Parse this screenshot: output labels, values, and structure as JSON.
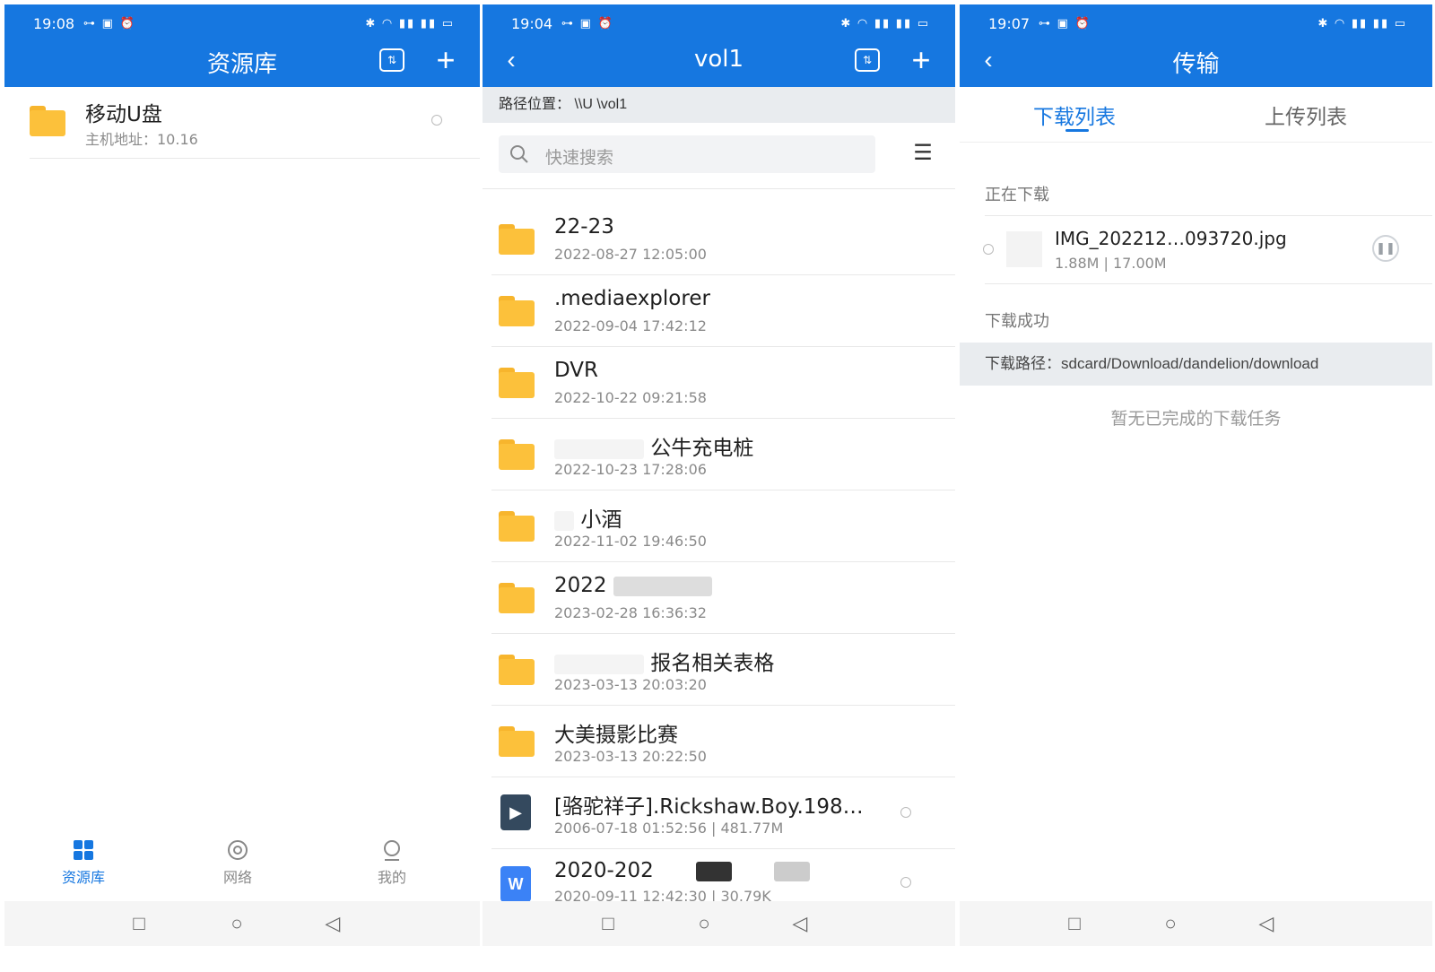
{
  "status_times": [
    "19:08",
    "19:04",
    "19:07"
  ],
  "status": {
    "left_icons": "⊶ ▣ ⏰",
    "right_icons": "✱ ◠ ▮▮ ▮▮ ▭"
  },
  "screen1": {
    "title": "资源库",
    "items": [
      {
        "name": "移动U盘",
        "meta": "主机地址：10.16"
      }
    ],
    "nav": [
      {
        "label": "资源库",
        "icon": "grid-icon",
        "active": true
      },
      {
        "label": "网络",
        "icon": "network-icon",
        "active": false
      },
      {
        "label": "我的",
        "icon": "user-icon",
        "active": false
      }
    ]
  },
  "screen2": {
    "title": "vol1",
    "path": "路径位置： \\\\U \\vol1",
    "search_placeholder": "快速搜索",
    "items": [
      {
        "name": "22-23",
        "meta": "2022-08-27 12:05:00",
        "type": "folder"
      },
      {
        "name": ".mediaexplorer",
        "meta": "2022-09-04 17:42:12",
        "type": "folder"
      },
      {
        "name": "DVR",
        "meta": "2022-10-22 09:21:58",
        "type": "folder"
      },
      {
        "name": "公牛充电桩",
        "meta": "2022-10-23 17:28:06",
        "type": "folder"
      },
      {
        "name": "小酒",
        "meta": "2022-11-02 19:46:50",
        "type": "folder"
      },
      {
        "name": "2022",
        "meta": "2023-02-28 16:36:32",
        "type": "folder"
      },
      {
        "name": "报名相关表格",
        "meta": "2023-03-13 20:03:20",
        "type": "folder"
      },
      {
        "name": "大美摄影比赛",
        "meta": "2023-03-13 20:22:50",
        "type": "folder"
      },
      {
        "name": "[骆驼祥子].Rickshaw.Boy.198…",
        "meta": "2006-07-18 01:52:56  |  481.77M",
        "type": "video"
      },
      {
        "name": "2020-202",
        "meta": "2020-09-11 12:42:30  |  30.79K",
        "type": "word"
      }
    ]
  },
  "screen3": {
    "title": "传输",
    "tabs": [
      "下载列表",
      "上传列表"
    ],
    "downloading_label": "正在下载",
    "download_item": {
      "name": "IMG_202212…093720.jpg",
      "meta": "1.88M | 17.00M"
    },
    "success_label": "下载成功",
    "download_path": "下载路径：sdcard/Download/dandelion/download",
    "empty_text": "暂无已完成的下载任务"
  },
  "colors": {
    "brand": "#1677e0",
    "folder": "#fcc13b"
  }
}
